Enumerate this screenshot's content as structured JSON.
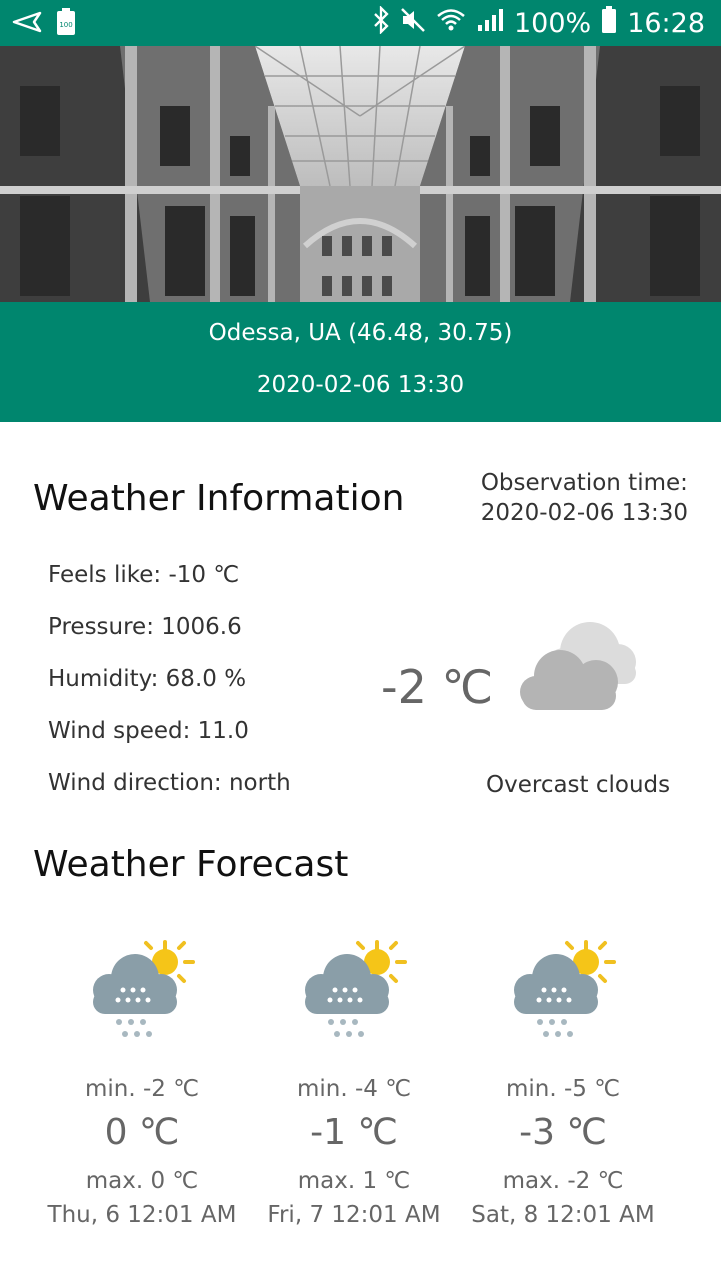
{
  "status_bar": {
    "battery_percent": "100%",
    "time": "16:28",
    "battery_badge": "100"
  },
  "header": {
    "location": "Odessa, UA (46.48, 30.75)",
    "datetime": "2020-02-06 13:30"
  },
  "weather_info": {
    "title": "Weather Information",
    "observation_label": "Observation time:",
    "observation_time": "2020-02-06 13:30",
    "feels_like": "Feels like: -10 ℃",
    "pressure": "Pressure: 1006.6",
    "humidity": "Humidity: 68.0 %",
    "wind_speed": "Wind speed: 11.0",
    "wind_direction": "Wind direction: north",
    "temperature": "-2 ℃",
    "condition": "Overcast clouds",
    "condition_icon": "overcast-clouds-icon"
  },
  "forecast": {
    "title": "Weather Forecast",
    "days": [
      {
        "min": "min. -2 ℃",
        "temp": "0 ℃",
        "max": "max. 0 ℃",
        "date": "Thu, 6 12:01 AM",
        "icon": "snow-sun-icon"
      },
      {
        "min": "min. -4 ℃",
        "temp": "-1 ℃",
        "max": "max. 1 ℃",
        "date": "Fri, 7 12:01 AM",
        "icon": "snow-sun-icon"
      },
      {
        "min": "min. -5 ℃",
        "temp": "-3 ℃",
        "max": "max. -2 ℃",
        "date": "Sat, 8 12:01 AM",
        "icon": "snow-sun-icon"
      }
    ]
  },
  "colors": {
    "accent": "#00866e",
    "text_muted": "#666666"
  }
}
